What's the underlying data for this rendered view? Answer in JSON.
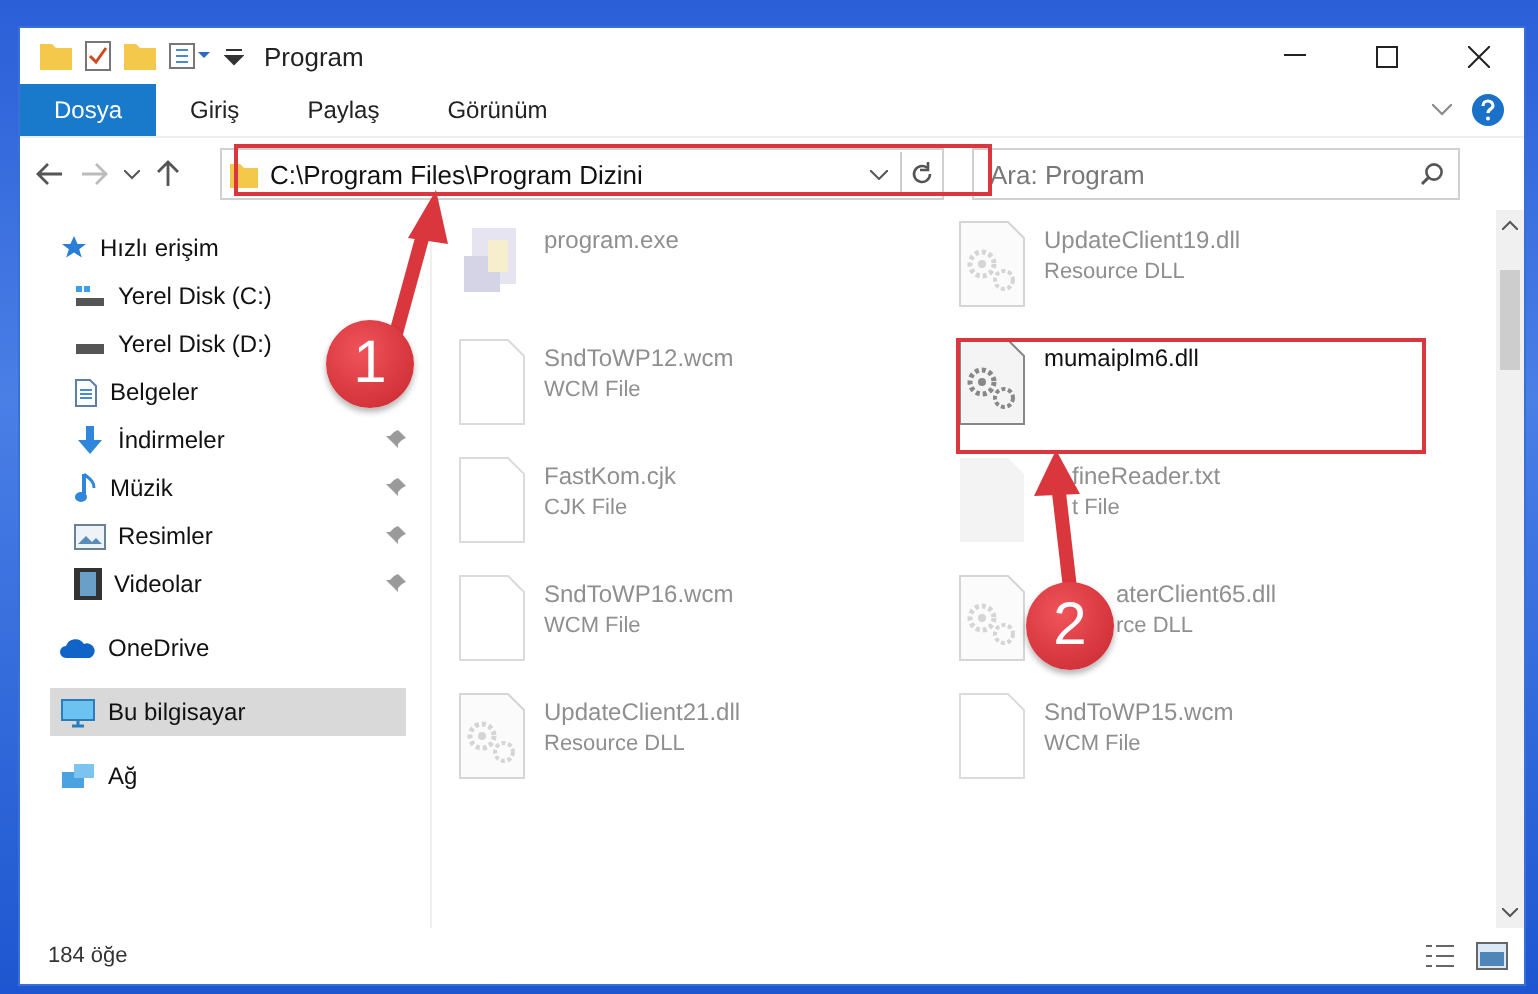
{
  "window": {
    "title": "Program"
  },
  "ribbon_tabs": [
    {
      "label": "Dosya",
      "selected": true
    },
    {
      "label": "Giriş",
      "selected": false
    },
    {
      "label": "Paylaş",
      "selected": false
    },
    {
      "label": "Görünüm",
      "selected": false
    }
  ],
  "address": {
    "path": "C:\\Program Files\\Program Dizini"
  },
  "search": {
    "placeholder": "Ara: Program"
  },
  "sidebar": {
    "items": [
      {
        "label": "Hızlı erişim",
        "kind": "star",
        "selected": false,
        "children": [
          {
            "label": "Yerel Disk (C:)",
            "kind": "drive-c",
            "pinned": false
          },
          {
            "label": "Yerel Disk (D:)",
            "kind": "drive",
            "pinned": false
          },
          {
            "label": "Belgeler",
            "kind": "document",
            "pinned": false
          },
          {
            "label": "İndirmeler",
            "kind": "download",
            "pinned": true
          },
          {
            "label": "Müzik",
            "kind": "music",
            "pinned": true
          },
          {
            "label": "Resimler",
            "kind": "image",
            "pinned": true
          },
          {
            "label": "Videolar",
            "kind": "video",
            "pinned": true
          }
        ]
      },
      {
        "label": "OneDrive",
        "kind": "cloud",
        "selected": false
      },
      {
        "label": "Bu bilgisayar",
        "kind": "computer",
        "selected": true
      },
      {
        "label": "Ağ",
        "kind": "network",
        "selected": false
      }
    ]
  },
  "files": [
    {
      "name": "program.exe",
      "kind": "exe",
      "faded": true
    },
    {
      "name": "UpdateClient19.dll",
      "type": "Resource DLL",
      "kind": "dll",
      "faded": true
    },
    {
      "name": "SndToWP12.wcm",
      "type": "WCM File",
      "kind": "blank",
      "faded": true
    },
    {
      "name": "mumaiplm6.dll",
      "kind": "dll",
      "faded": false
    },
    {
      "name": "FastKom.cjk",
      "type": "CJK File",
      "kind": "blank",
      "faded": true
    },
    {
      "name": "fineReader.txt",
      "type": "t File",
      "kind": "text",
      "faded": true
    },
    {
      "name": "SndToWP16.wcm",
      "type": "WCM File",
      "kind": "blank",
      "faded": true
    },
    {
      "name": "aterClient65.dll",
      "type": "rce DLL",
      "kind": "dll",
      "faded": true
    },
    {
      "name": "UpdateClient21.dll",
      "type": "Resource DLL",
      "kind": "dll",
      "faded": true
    },
    {
      "name": "SndToWP15.wcm",
      "type": "WCM File",
      "kind": "blank",
      "faded": true
    }
  ],
  "status_bar": {
    "count": "184 öğe"
  },
  "annotations": [
    {
      "number": "1"
    },
    {
      "number": "2"
    }
  ]
}
